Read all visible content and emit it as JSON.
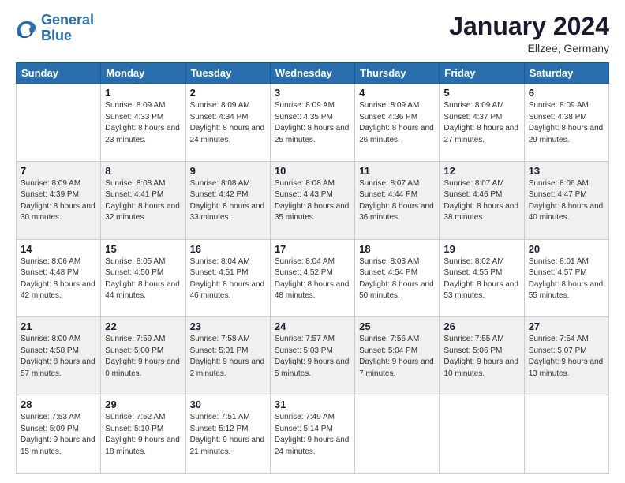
{
  "logo": {
    "line1": "General",
    "line2": "Blue"
  },
  "title": "January 2024",
  "location": "Ellzee, Germany",
  "headers": [
    "Sunday",
    "Monday",
    "Tuesday",
    "Wednesday",
    "Thursday",
    "Friday",
    "Saturday"
  ],
  "weeks": [
    [
      {
        "date": "",
        "sunrise": "",
        "sunset": "",
        "daylight": ""
      },
      {
        "date": "1",
        "sunrise": "Sunrise: 8:09 AM",
        "sunset": "Sunset: 4:33 PM",
        "daylight": "Daylight: 8 hours and 23 minutes."
      },
      {
        "date": "2",
        "sunrise": "Sunrise: 8:09 AM",
        "sunset": "Sunset: 4:34 PM",
        "daylight": "Daylight: 8 hours and 24 minutes."
      },
      {
        "date": "3",
        "sunrise": "Sunrise: 8:09 AM",
        "sunset": "Sunset: 4:35 PM",
        "daylight": "Daylight: 8 hours and 25 minutes."
      },
      {
        "date": "4",
        "sunrise": "Sunrise: 8:09 AM",
        "sunset": "Sunset: 4:36 PM",
        "daylight": "Daylight: 8 hours and 26 minutes."
      },
      {
        "date": "5",
        "sunrise": "Sunrise: 8:09 AM",
        "sunset": "Sunset: 4:37 PM",
        "daylight": "Daylight: 8 hours and 27 minutes."
      },
      {
        "date": "6",
        "sunrise": "Sunrise: 8:09 AM",
        "sunset": "Sunset: 4:38 PM",
        "daylight": "Daylight: 8 hours and 29 minutes."
      }
    ],
    [
      {
        "date": "7",
        "sunrise": "Sunrise: 8:09 AM",
        "sunset": "Sunset: 4:39 PM",
        "daylight": "Daylight: 8 hours and 30 minutes."
      },
      {
        "date": "8",
        "sunrise": "Sunrise: 8:08 AM",
        "sunset": "Sunset: 4:41 PM",
        "daylight": "Daylight: 8 hours and 32 minutes."
      },
      {
        "date": "9",
        "sunrise": "Sunrise: 8:08 AM",
        "sunset": "Sunset: 4:42 PM",
        "daylight": "Daylight: 8 hours and 33 minutes."
      },
      {
        "date": "10",
        "sunrise": "Sunrise: 8:08 AM",
        "sunset": "Sunset: 4:43 PM",
        "daylight": "Daylight: 8 hours and 35 minutes."
      },
      {
        "date": "11",
        "sunrise": "Sunrise: 8:07 AM",
        "sunset": "Sunset: 4:44 PM",
        "daylight": "Daylight: 8 hours and 36 minutes."
      },
      {
        "date": "12",
        "sunrise": "Sunrise: 8:07 AM",
        "sunset": "Sunset: 4:46 PM",
        "daylight": "Daylight: 8 hours and 38 minutes."
      },
      {
        "date": "13",
        "sunrise": "Sunrise: 8:06 AM",
        "sunset": "Sunset: 4:47 PM",
        "daylight": "Daylight: 8 hours and 40 minutes."
      }
    ],
    [
      {
        "date": "14",
        "sunrise": "Sunrise: 8:06 AM",
        "sunset": "Sunset: 4:48 PM",
        "daylight": "Daylight: 8 hours and 42 minutes."
      },
      {
        "date": "15",
        "sunrise": "Sunrise: 8:05 AM",
        "sunset": "Sunset: 4:50 PM",
        "daylight": "Daylight: 8 hours and 44 minutes."
      },
      {
        "date": "16",
        "sunrise": "Sunrise: 8:04 AM",
        "sunset": "Sunset: 4:51 PM",
        "daylight": "Daylight: 8 hours and 46 minutes."
      },
      {
        "date": "17",
        "sunrise": "Sunrise: 8:04 AM",
        "sunset": "Sunset: 4:52 PM",
        "daylight": "Daylight: 8 hours and 48 minutes."
      },
      {
        "date": "18",
        "sunrise": "Sunrise: 8:03 AM",
        "sunset": "Sunset: 4:54 PM",
        "daylight": "Daylight: 8 hours and 50 minutes."
      },
      {
        "date": "19",
        "sunrise": "Sunrise: 8:02 AM",
        "sunset": "Sunset: 4:55 PM",
        "daylight": "Daylight: 8 hours and 53 minutes."
      },
      {
        "date": "20",
        "sunrise": "Sunrise: 8:01 AM",
        "sunset": "Sunset: 4:57 PM",
        "daylight": "Daylight: 8 hours and 55 minutes."
      }
    ],
    [
      {
        "date": "21",
        "sunrise": "Sunrise: 8:00 AM",
        "sunset": "Sunset: 4:58 PM",
        "daylight": "Daylight: 8 hours and 57 minutes."
      },
      {
        "date": "22",
        "sunrise": "Sunrise: 7:59 AM",
        "sunset": "Sunset: 5:00 PM",
        "daylight": "Daylight: 9 hours and 0 minutes."
      },
      {
        "date": "23",
        "sunrise": "Sunrise: 7:58 AM",
        "sunset": "Sunset: 5:01 PM",
        "daylight": "Daylight: 9 hours and 2 minutes."
      },
      {
        "date": "24",
        "sunrise": "Sunrise: 7:57 AM",
        "sunset": "Sunset: 5:03 PM",
        "daylight": "Daylight: 9 hours and 5 minutes."
      },
      {
        "date": "25",
        "sunrise": "Sunrise: 7:56 AM",
        "sunset": "Sunset: 5:04 PM",
        "daylight": "Daylight: 9 hours and 7 minutes."
      },
      {
        "date": "26",
        "sunrise": "Sunrise: 7:55 AM",
        "sunset": "Sunset: 5:06 PM",
        "daylight": "Daylight: 9 hours and 10 minutes."
      },
      {
        "date": "27",
        "sunrise": "Sunrise: 7:54 AM",
        "sunset": "Sunset: 5:07 PM",
        "daylight": "Daylight: 9 hours and 13 minutes."
      }
    ],
    [
      {
        "date": "28",
        "sunrise": "Sunrise: 7:53 AM",
        "sunset": "Sunset: 5:09 PM",
        "daylight": "Daylight: 9 hours and 15 minutes."
      },
      {
        "date": "29",
        "sunrise": "Sunrise: 7:52 AM",
        "sunset": "Sunset: 5:10 PM",
        "daylight": "Daylight: 9 hours and 18 minutes."
      },
      {
        "date": "30",
        "sunrise": "Sunrise: 7:51 AM",
        "sunset": "Sunset: 5:12 PM",
        "daylight": "Daylight: 9 hours and 21 minutes."
      },
      {
        "date": "31",
        "sunrise": "Sunrise: 7:49 AM",
        "sunset": "Sunset: 5:14 PM",
        "daylight": "Daylight: 9 hours and 24 minutes."
      },
      {
        "date": "",
        "sunrise": "",
        "sunset": "",
        "daylight": ""
      },
      {
        "date": "",
        "sunrise": "",
        "sunset": "",
        "daylight": ""
      },
      {
        "date": "",
        "sunrise": "",
        "sunset": "",
        "daylight": ""
      }
    ]
  ]
}
